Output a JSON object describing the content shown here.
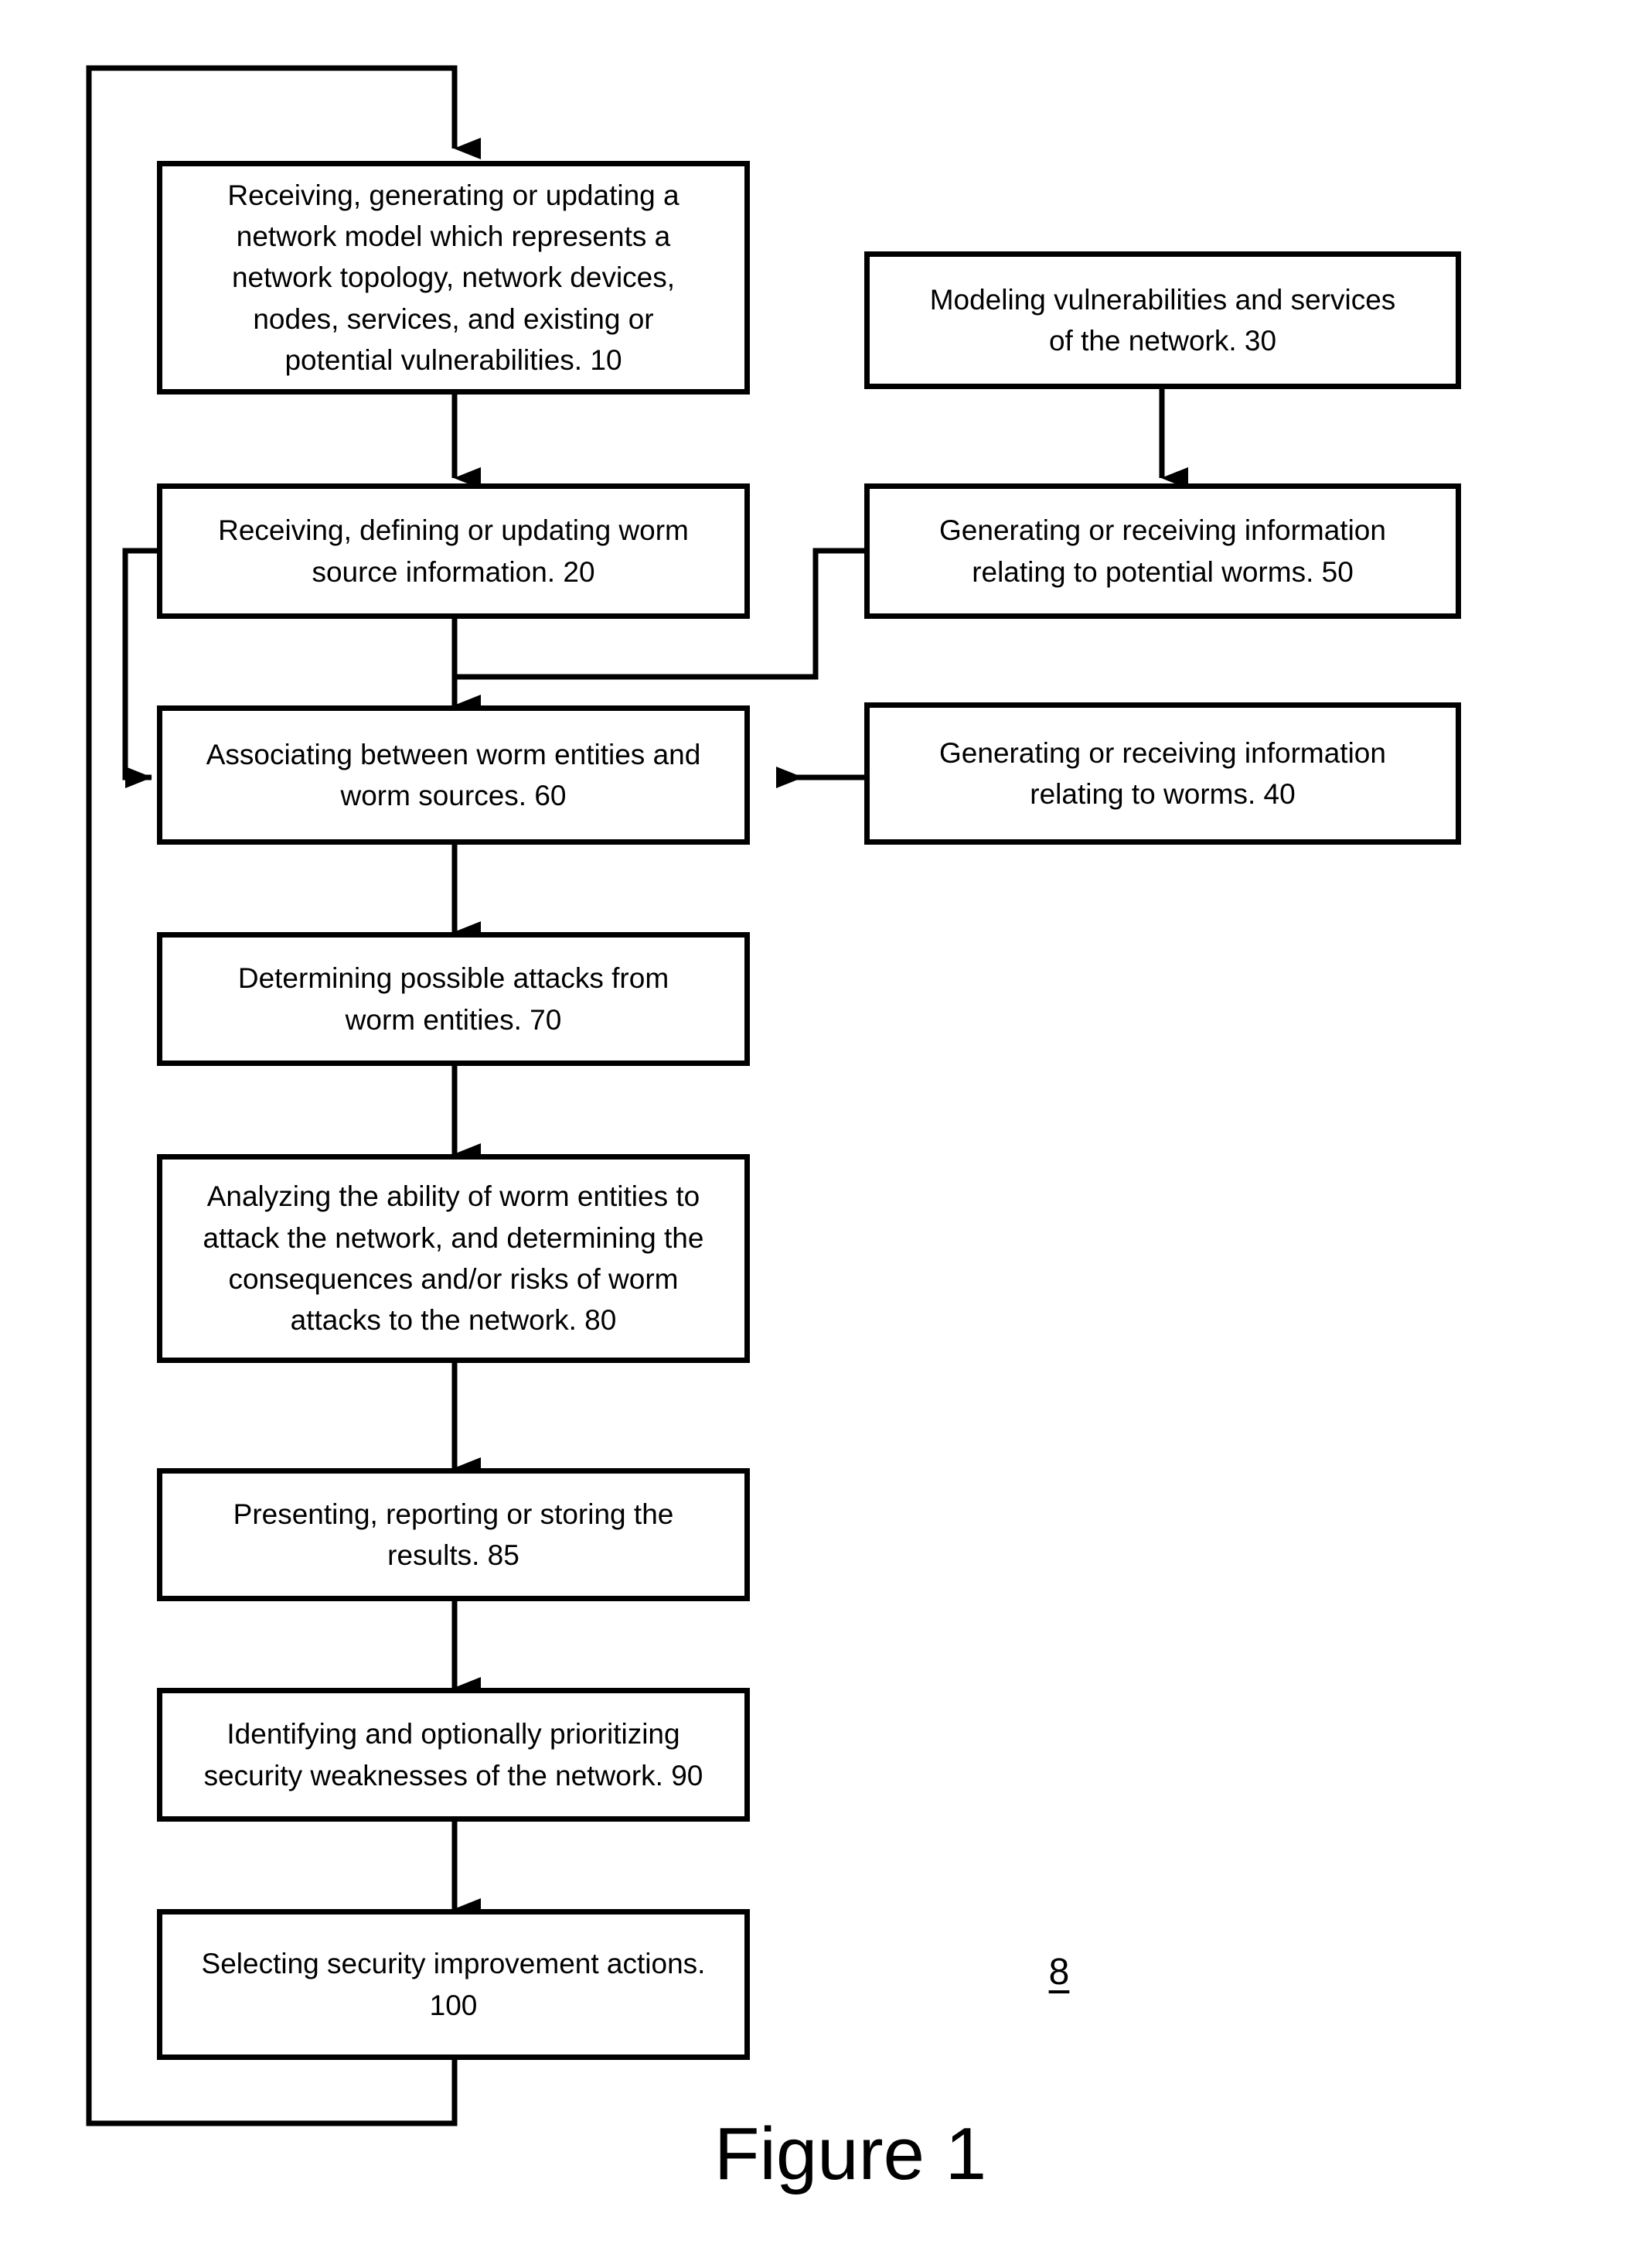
{
  "figure": {
    "caption": "Figure 1",
    "reference_numeral": "8"
  },
  "diagram": {
    "type": "flowchart",
    "title": "Figure 1",
    "line_color": "#000000",
    "background_color": "#ffffff",
    "boxes": [
      {
        "id": "10",
        "name": "network-model-step",
        "text": "Receiving, generating or updating a\nnetwork model which represents a\nnetwork topology, network devices,\nnodes, services, and existing or\npotential vulnerabilities.   10"
      },
      {
        "id": "30",
        "name": "modeling-vulnerabilities-step",
        "text": "Modeling vulnerabilities and services\nof the network.  30"
      },
      {
        "id": "20",
        "name": "worm-source-information-step",
        "text": "Receiving, defining or updating worm\nsource information. 20"
      },
      {
        "id": "50",
        "name": "potential-worms-information-step",
        "text": "Generating or receiving information\nrelating to potential worms. 50"
      },
      {
        "id": "60",
        "name": "associating-worm-entities-step",
        "text": "Associating between worm entities and\nworm sources. 60"
      },
      {
        "id": "40",
        "name": "worms-information-step",
        "text": "Generating or receiving information\nrelating to worms. 40"
      },
      {
        "id": "70",
        "name": "determining-possible-attacks-step",
        "text": "Determining possible attacks from\nworm entities. 70"
      },
      {
        "id": "80",
        "name": "analyzing-ability-step",
        "text": "Analyzing the ability of worm entities to\nattack the network, and determining the\nconsequences and/or risks of worm\nattacks to the network. 80"
      },
      {
        "id": "85",
        "name": "presenting-results-step",
        "text": "Presenting, reporting or storing the\nresults. 85"
      },
      {
        "id": "90",
        "name": "identifying-weaknesses-step",
        "text": "Identifying and optionally prioritizing\nsecurity weaknesses of the network. 90"
      },
      {
        "id": "100",
        "name": "selecting-actions-step",
        "text": "Selecting security improvement actions.\n100"
      }
    ],
    "connectors": [
      {
        "name": "feedback-loop-to-step-10",
        "from": "100",
        "to": "10"
      },
      {
        "name": "arrow-step-10-to-step-20",
        "from": "10",
        "to": "20"
      },
      {
        "name": "arrow-step-30-to-step-50",
        "from": "30",
        "to": "50"
      },
      {
        "name": "arrow-step-20-to-step-60",
        "from": "20",
        "to": "60"
      },
      {
        "name": "arrow-step-50-to-step-60",
        "from": "50",
        "to": "60"
      },
      {
        "name": "arrow-step-40-to-step-60",
        "from": "40",
        "to": "60"
      },
      {
        "name": "arrow-step-20-left-into-step-60",
        "from": "20",
        "to": "60"
      },
      {
        "name": "arrow-step-60-to-step-70",
        "from": "60",
        "to": "70"
      },
      {
        "name": "arrow-step-70-to-step-80",
        "from": "70",
        "to": "80"
      },
      {
        "name": "arrow-step-80-to-step-85",
        "from": "80",
        "to": "85"
      },
      {
        "name": "arrow-step-85-to-step-90",
        "from": "85",
        "to": "90"
      },
      {
        "name": "arrow-step-90-to-step-100",
        "from": "90",
        "to": "100"
      }
    ]
  }
}
